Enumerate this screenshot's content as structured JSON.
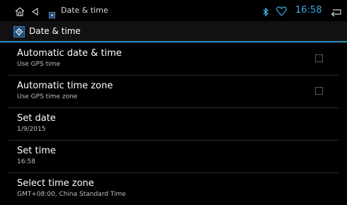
{
  "status_bar": {
    "notification_title": "Date & time",
    "clock": "16:58",
    "icons": [
      "home-icon",
      "back-icon",
      "settings-app-icon",
      "bluetooth-icon",
      "heart-icon",
      "return-icon"
    ],
    "accent_color": "#3aa9df"
  },
  "action_bar": {
    "title": "Date & time",
    "icon": "gear-icon",
    "divider_color": "#2e8fc6"
  },
  "settings": [
    {
      "title": "Automatic date & time",
      "subtitle": "Use GPS time",
      "checkbox": true,
      "checked": false
    },
    {
      "title": "Automatic time zone",
      "subtitle": "Use GPS time zone",
      "checkbox": true,
      "checked": false
    },
    {
      "title": "Set date",
      "subtitle": "1/9/2015",
      "checkbox": false
    },
    {
      "title": "Set time",
      "subtitle": "16:58",
      "checkbox": false
    },
    {
      "title": "Select time zone",
      "subtitle": "GMT+08:00, China Standard Time",
      "checkbox": false
    }
  ]
}
